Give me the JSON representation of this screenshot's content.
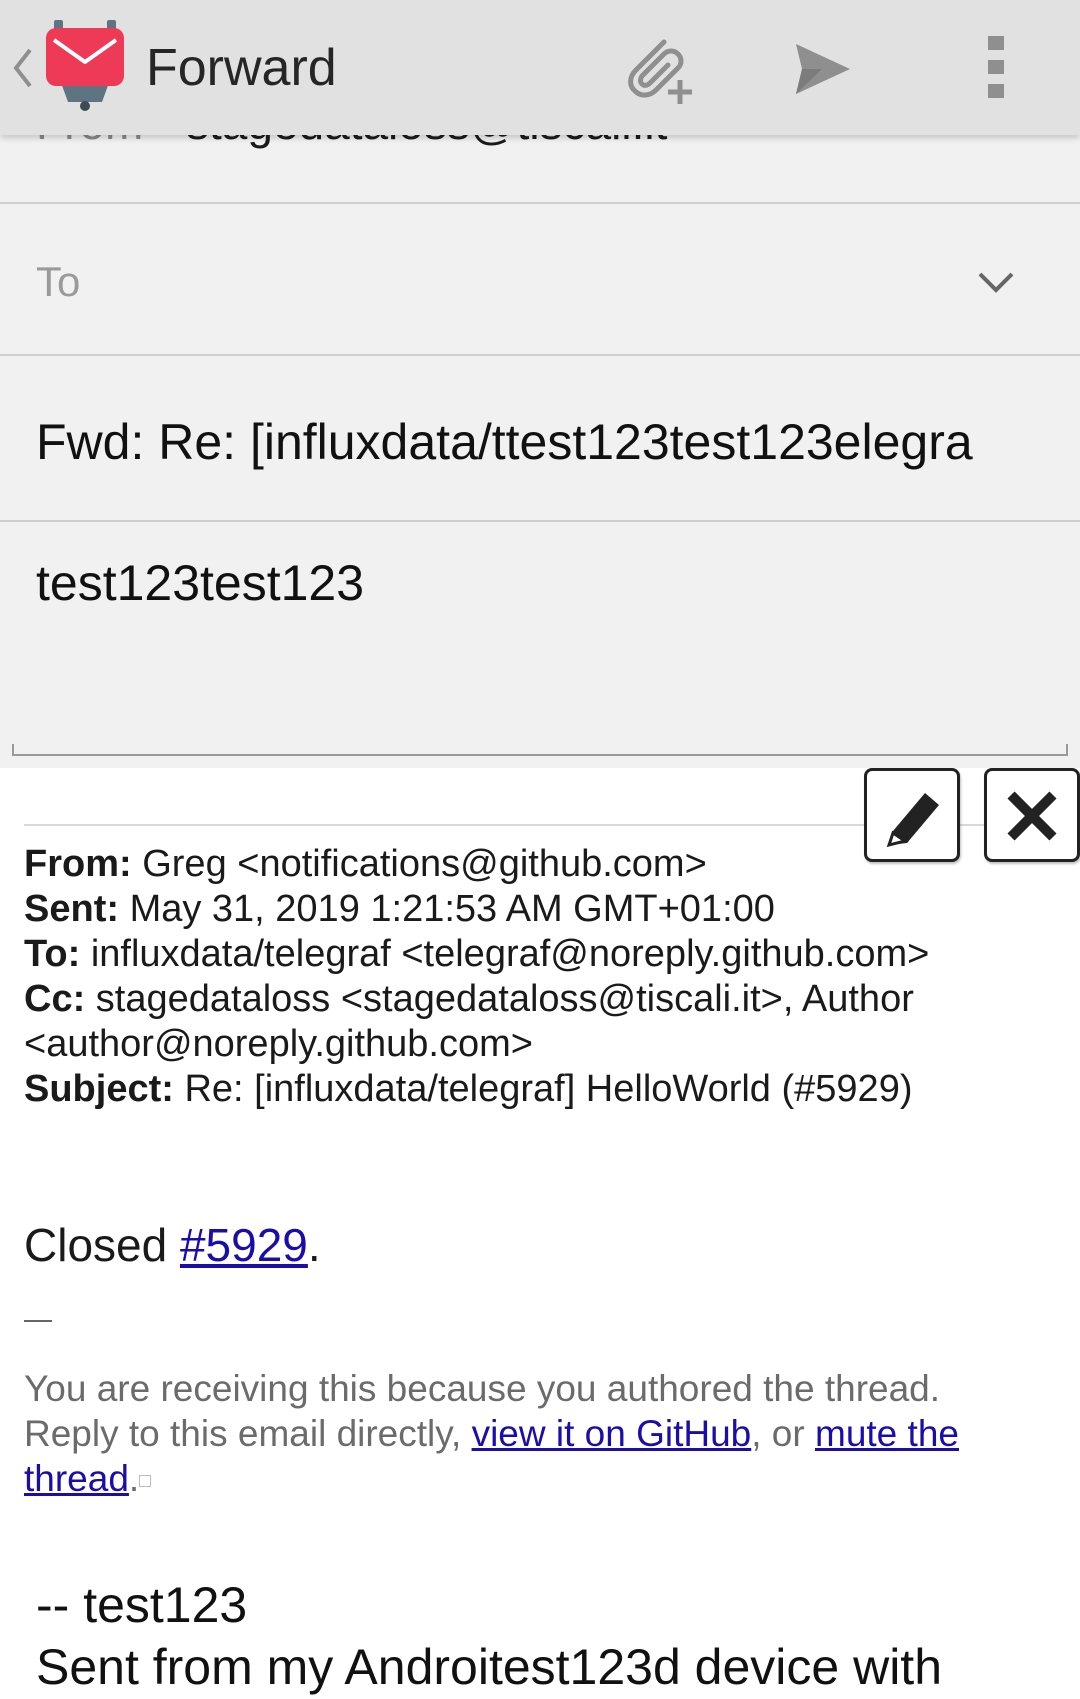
{
  "actionbar": {
    "title": "Forward",
    "icons": [
      "up-chevron-icon",
      "k9-mail-logo-icon",
      "attach-icon",
      "send-icon",
      "overflow-menu-icon"
    ],
    "colors": {
      "bar": "#e1e1e1",
      "logo_red": "#ef3a57",
      "logo_steel": "#5f7482",
      "icon_gray": "#8f8f8f"
    }
  },
  "compose": {
    "from_label": "From",
    "from_value": "stagedataloss@tiscali.it",
    "to_placeholder": "To",
    "subject": "Fwd: Re: [influxdata/ttest123test123elegra",
    "body": "test123test123"
  },
  "quoted": {
    "from_key": "From:",
    "from_val": "Greg <notifications@github.com>",
    "sent_key": "Sent:",
    "sent_val": "May 31, 2019 1:21:53 AM GMT+01:00",
    "to_key": "To:",
    "to_val": "influxdata/telegraf <telegraf@noreply.github.com>",
    "cc_key": "Cc:",
    "cc_val": "stagedataloss <stagedataloss@tiscali.it>, Author <author@noreply.github.com>",
    "subject_key": "Subject:",
    "subject_val": "Re: [influxdata/telegraf] HelloWorld (#5929)",
    "closed_prefix": "Closed ",
    "closed_link": "#5929",
    "closed_suffix": ".",
    "footer_line1": "You are receiving this because you authored the thread.",
    "footer_line2_prefix": "Reply to this email directly, ",
    "footer_link1": "view it on GitHub",
    "footer_mid": ", or ",
    "footer_link2": "mute the thread",
    "footer_end": ".",
    "link_color": "#1a0dab"
  },
  "signature": {
    "line1": "-- test123",
    "line2": "Sent from my Androitest123d device with"
  }
}
